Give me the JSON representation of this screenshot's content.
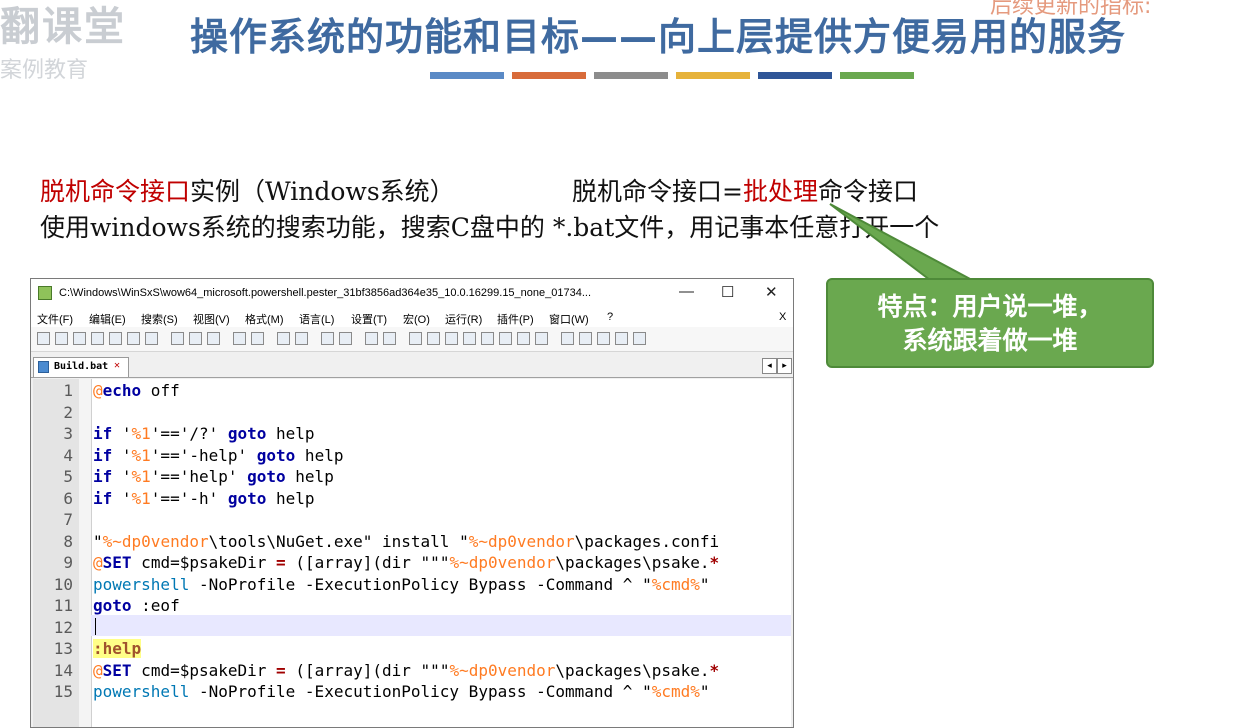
{
  "brand": {
    "logo_main": "翻课堂",
    "logo_sub": "案例教育",
    "corner_text": "后续更新的指标:"
  },
  "slide": {
    "title": "操作系统的功能和目标——向上层提供方便易用的服务",
    "bar_colors": [
      "#5a8ac6",
      "#d86b3a",
      "#8c8c8c",
      "#e6b23a",
      "#2f5597",
      "#6aa84f"
    ],
    "line1_red": "脱机命令接口",
    "line1_rest": "实例（Windows系统）",
    "line1b_pre": "脱机命令接口=",
    "line1b_red": "批处理",
    "line1b_post": "命令接口",
    "line2": "使用windows系统的搜索功能，搜索C盘中的 *.bat文件，用记事本任意打开一个",
    "callout_line1": "特点：用户说一堆，",
    "callout_line2": "系统跟着做一堆"
  },
  "window": {
    "title": "C:\\Windows\\WinSxS\\wow64_microsoft.powershell.pester_31bf3856ad364e35_10.0.16299.15_none_01734...",
    "minimize": "—",
    "maximize": "☐",
    "close": "✕",
    "menu": [
      "文件(F)",
      "编辑(E)",
      "搜索(S)",
      "视图(V)",
      "格式(M)",
      "语言(L)",
      "设置(T)",
      "宏(O)",
      "运行(R)",
      "插件(P)",
      "窗口(W)",
      "?"
    ],
    "menu_close": "X",
    "tab_label": "Build.bat",
    "tab_close": "✕",
    "nav_left": "◂",
    "nav_right": "▸"
  },
  "editor": {
    "line_numbers": [
      "1",
      "2",
      "3",
      "4",
      "5",
      "6",
      "7",
      "8",
      "9",
      "10",
      "11",
      "12",
      "13",
      "14",
      "15"
    ],
    "lines": [
      "@echo off",
      "",
      "if '%1'=='/?' goto help",
      "if '%1'=='-help' goto help",
      "if '%1'=='help' goto help",
      "if '%1'=='-h' goto help",
      "",
      "\"%~dp0vendor\\tools\\NuGet.exe\" install \"%~dp0vendor\\packages.confi",
      "@SET cmd=$psakeDir = ([array](dir \"\"\"%~dp0vendor\\packages\\psake.*",
      "powershell -NoProfile -ExecutionPolicy Bypass -Command ^ \"%cmd%\"",
      "goto :eof",
      "",
      ":help",
      "@SET cmd=$psakeDir = ([array](dir \"\"\"%~dp0vendor\\packages\\psake.*",
      "powershell -NoProfile -ExecutionPolicy Bypass -Command ^ \"%cmd%\""
    ]
  }
}
